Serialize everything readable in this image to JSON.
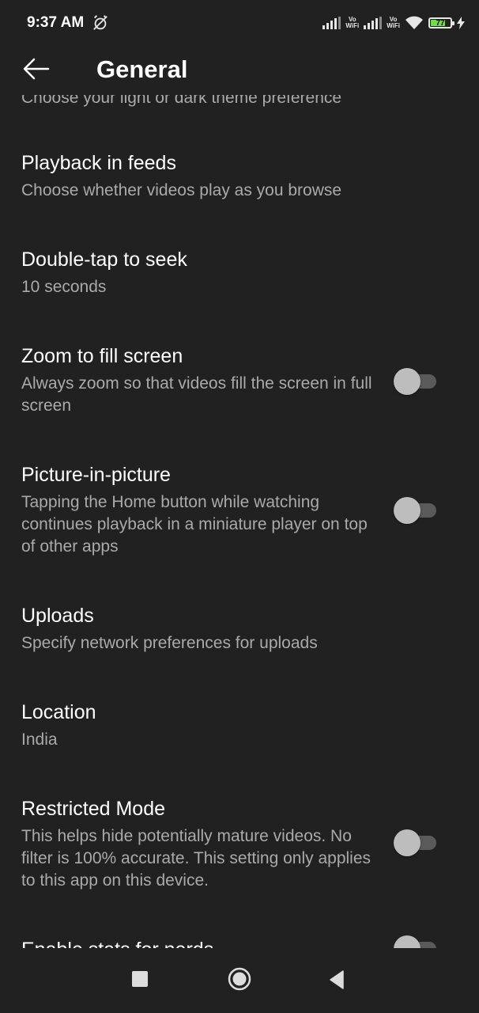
{
  "status_bar": {
    "time": "9:37 AM",
    "alarm_icon": "alarm-off-icon",
    "vowifi_label_1": "Vo\nWiFi",
    "vowifi_label_2": "Vo\nWiFi",
    "battery_level": "77",
    "charging_icon": "bolt-icon"
  },
  "app_bar": {
    "back_icon": "arrow-left-icon",
    "title": "General"
  },
  "settings": {
    "peek_text": "Choose your light or dark theme preference",
    "items": [
      {
        "title": "Playback in feeds",
        "description": "Choose whether videos play as you browse"
      },
      {
        "title": "Double-tap to seek",
        "description": "10 seconds"
      },
      {
        "title": "Zoom to fill screen",
        "description": "Always zoom so that videos fill the screen in full screen",
        "toggle": false
      },
      {
        "title": "Picture-in-picture",
        "description": "Tapping the Home button while watching continues playback in a miniature player on top of other apps",
        "toggle": false
      },
      {
        "title": "Uploads",
        "description": "Specify network preferences for uploads"
      },
      {
        "title": "Location",
        "description": "India"
      },
      {
        "title": "Restricted Mode",
        "description": "This helps hide potentially mature videos. No filter is 100% accurate. This setting only applies to this app on this device.",
        "toggle": false
      },
      {
        "title": "Enable stats for nerds",
        "toggle": false
      }
    ]
  },
  "nav_bar": {
    "recents_icon": "square-recents-icon",
    "home_icon": "circle-home-icon",
    "back_icon": "triangle-back-icon"
  },
  "colors": {
    "background": "#212121",
    "primary_text": "#ffffff",
    "secondary_text": "#aaaaaa",
    "toggle_off_thumb": "#bdbdbd",
    "toggle_off_track": "#5a5a5a",
    "battery": "#6fdc4a"
  }
}
